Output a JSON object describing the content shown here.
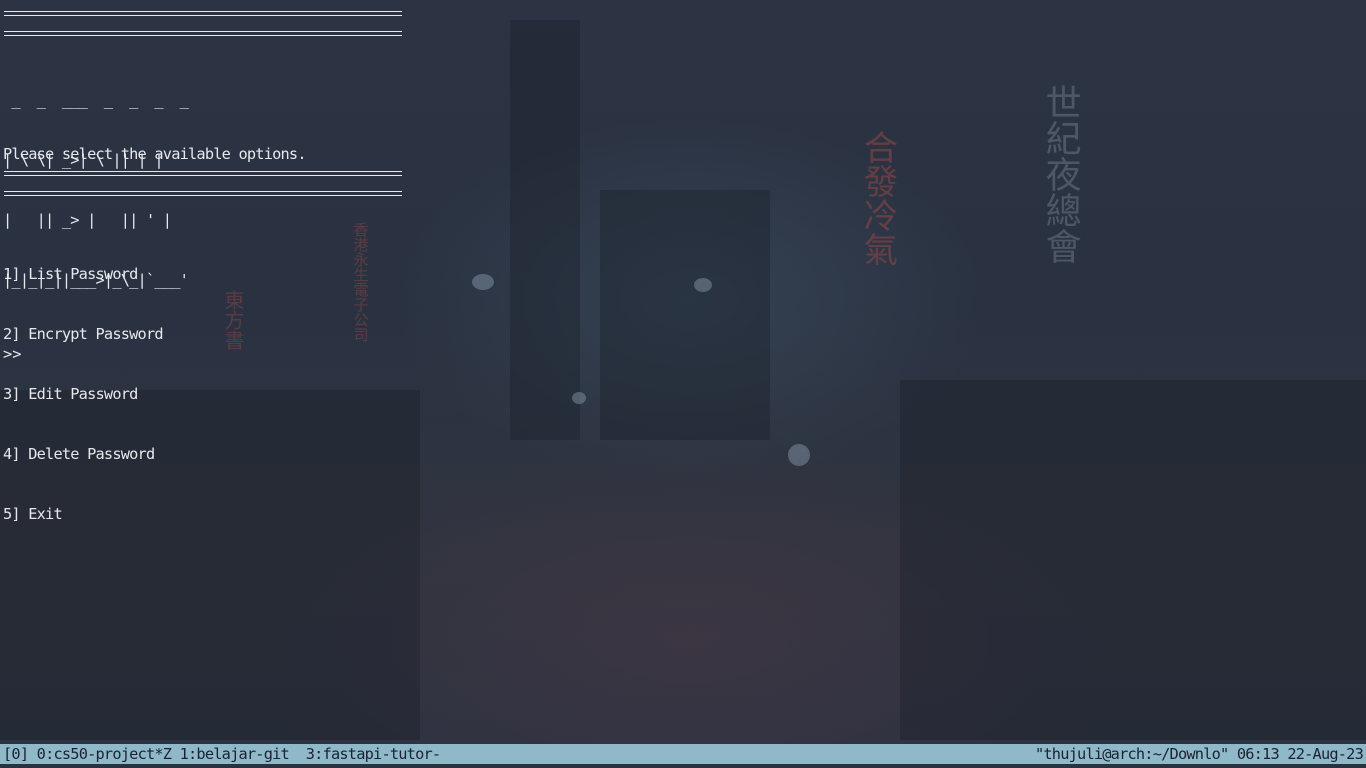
{
  "terminal": {
    "ascii_logo": [
      " _  _  ___  _  _  _  _",
      "| \\ \\| _>| \\ || | |",
      "|   || _> |   || ' |",
      "|_|_|_||___>|_\\_|`___'"
    ],
    "instruction": "Please select the available options.",
    "menu": [
      "1] List Password",
      "2] Encrypt Password",
      "3] Edit Password",
      "4] Delete Password",
      "5] Exit"
    ],
    "prompt": ">>"
  },
  "statusbar": {
    "session": "[0]",
    "windows": "0:cs50-project*Z 1:belajar-git  3:fastapi-tutor-",
    "host": "\"thujuli@arch:~/Downlo\"",
    "time": "06:13",
    "date": "22-Aug-23"
  },
  "colors": {
    "background": "#2b3342",
    "text": "#e6e8ec",
    "statusbar_bg": "#8fb8c8",
    "statusbar_fg": "#1a2230"
  }
}
